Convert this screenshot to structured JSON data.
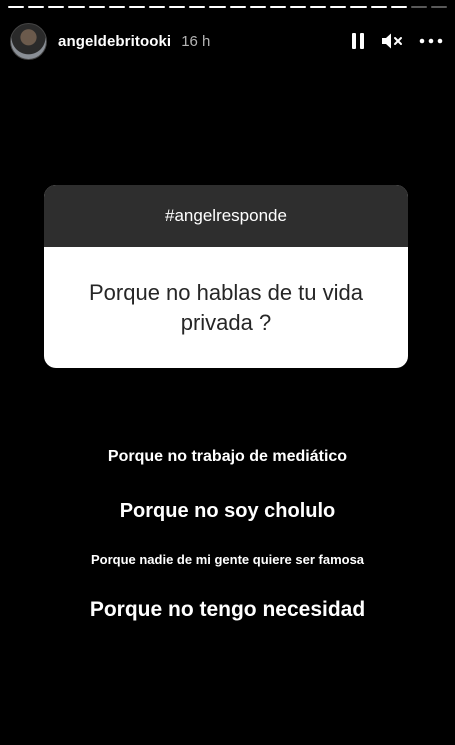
{
  "story": {
    "progress": {
      "segments_total": 22,
      "segments_viewed": 20
    },
    "header": {
      "username": "angeldebritooki",
      "time": "16 h",
      "icons": [
        "avatar",
        "pause-icon",
        "mute-icon",
        "more-options-icon"
      ]
    },
    "question_sticker": {
      "title": "#angelresponde",
      "question": "Porque no hablas de tu vida privada ?",
      "colors": {
        "header_bg": "#2e2e2e",
        "body_bg": "#ffffff",
        "body_text": "#262626"
      }
    },
    "answers": [
      "Porque no trabajo de mediático",
      "Porque no soy cholulo",
      "Porque nadie de mi gente quiere ser famosa",
      "Porque no tengo necesidad"
    ]
  }
}
